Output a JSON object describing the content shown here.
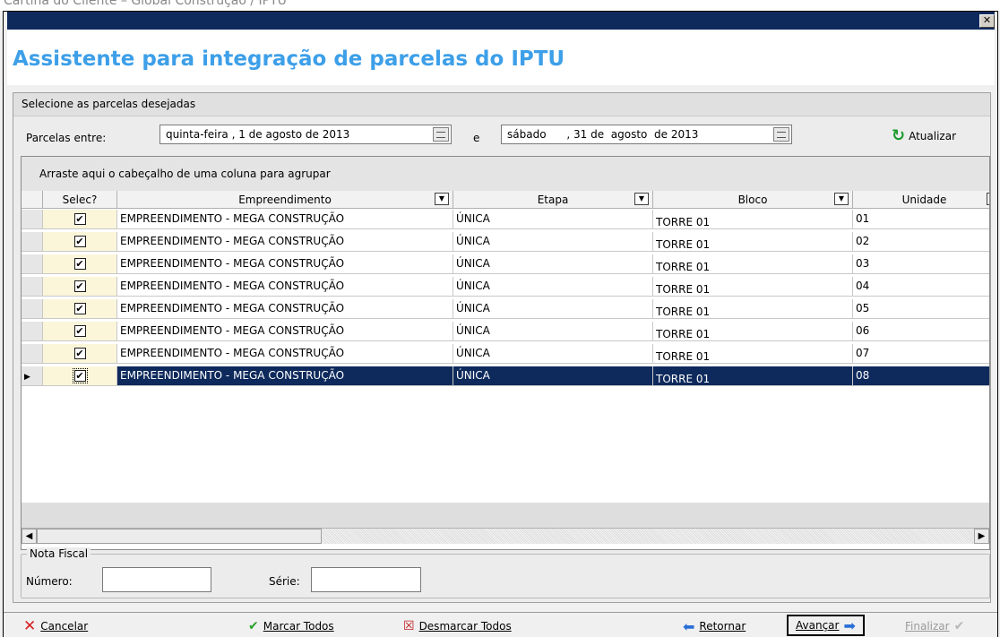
{
  "background_title": "Cartina do Cliente – Global Construção / IPTU",
  "close_glyph": "✕",
  "header": {
    "title": "Assistente para integração de parcelas do IPTU"
  },
  "panel": {
    "heading": "Selecione as parcelas desejadas"
  },
  "filter": {
    "label": "Parcelas entre:",
    "date_from": "quinta-feira ,  1 de  agosto  de 2013",
    "connector": "e",
    "date_to": "sábado      , 31 de  agosto  de 2013",
    "refresh_label": "Atualizar"
  },
  "grid": {
    "group_hint": "Arraste aqui o cabeçalho de uma coluna para agrupar",
    "columns": [
      "Selec?",
      "Empreendimento",
      "Etapa",
      "Bloco",
      "Unidade"
    ],
    "rows": [
      {
        "selected": "✔",
        "empreendimento": "EMPREENDIMENTO - MEGA CONSTRUÇÃO",
        "etapa": "ÚNICA",
        "bloco": "TORRE 01",
        "unidade": "01"
      },
      {
        "selected": "✔",
        "empreendimento": "EMPREENDIMENTO - MEGA CONSTRUÇÃO",
        "etapa": "ÚNICA",
        "bloco": "TORRE 01",
        "unidade": "02"
      },
      {
        "selected": "✔",
        "empreendimento": "EMPREENDIMENTO - MEGA CONSTRUÇÃO",
        "etapa": "ÚNICA",
        "bloco": "TORRE 01",
        "unidade": "03"
      },
      {
        "selected": "✔",
        "empreendimento": "EMPREENDIMENTO - MEGA CONSTRUÇÃO",
        "etapa": "ÚNICA",
        "bloco": "TORRE 01",
        "unidade": "04"
      },
      {
        "selected": "✔",
        "empreendimento": "EMPREENDIMENTO - MEGA CONSTRUÇÃO",
        "etapa": "ÚNICA",
        "bloco": "TORRE 01",
        "unidade": "05"
      },
      {
        "selected": "✔",
        "empreendimento": "EMPREENDIMENTO - MEGA CONSTRUÇÃO",
        "etapa": "ÚNICA",
        "bloco": "TORRE 01",
        "unidade": "06"
      },
      {
        "selected": "✔",
        "empreendimento": "EMPREENDIMENTO - MEGA CONSTRUÇÃO",
        "etapa": "ÚNICA",
        "bloco": "TORRE 01",
        "unidade": "07"
      },
      {
        "selected": "✔",
        "empreendimento": "EMPREENDIMENTO - MEGA CONSTRUÇÃO",
        "etapa": "ÚNICA",
        "bloco": "TORRE 01",
        "unidade": "08"
      }
    ]
  },
  "nota_fiscal": {
    "legend": "Nota Fiscal",
    "numero_label": "Número:",
    "numero_value": "",
    "serie_label": "Série:",
    "serie_value": ""
  },
  "buttons": {
    "cancel": "Cancelar",
    "mark_all": "Marcar Todos",
    "unmark_all": "Desmarcar Todos",
    "back": "Retornar",
    "next": "Avançar",
    "finish": "Finalizar"
  }
}
